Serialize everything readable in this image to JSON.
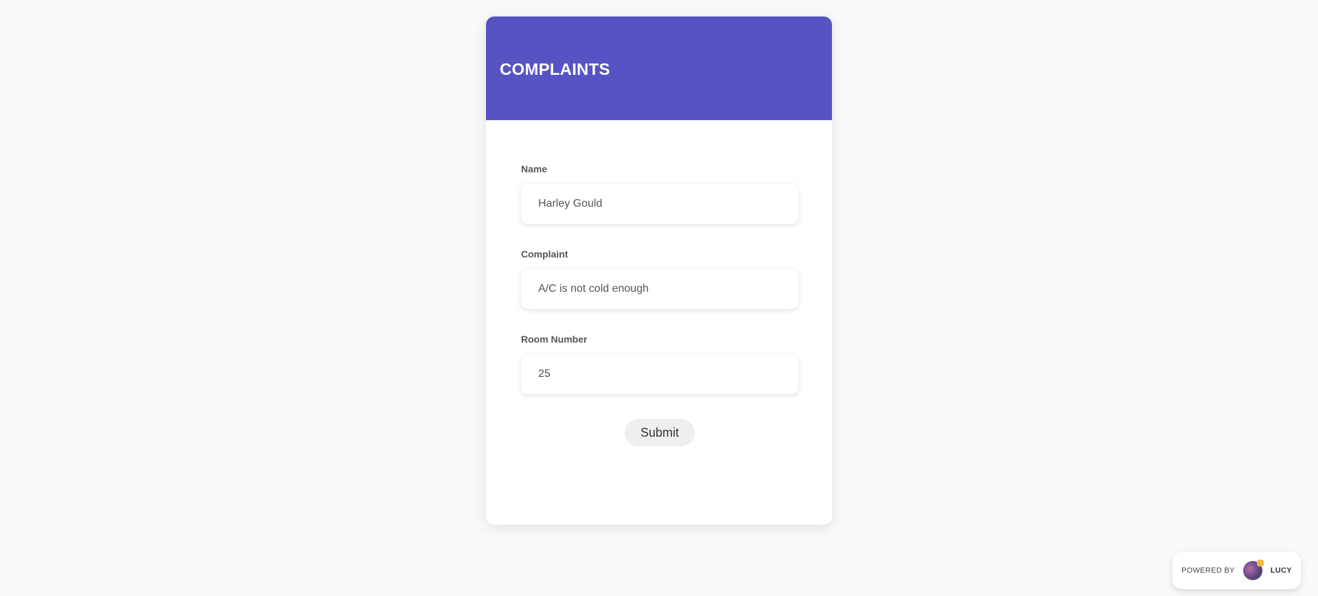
{
  "card": {
    "title": "COMPLAINTS"
  },
  "form": {
    "fields": [
      {
        "label": "Name",
        "value": "Harley Gould"
      },
      {
        "label": "Complaint",
        "value": "A/C is not cold enough"
      },
      {
        "label": "Room Number",
        "value": "25"
      }
    ],
    "submit_label": "Submit"
  },
  "footer": {
    "powered_by": "POWERED BY",
    "brand": "LUCY",
    "brand_icon": "lucy-logo-icon"
  },
  "colors": {
    "header": "#5753c4",
    "background": "#f9f9f9"
  }
}
